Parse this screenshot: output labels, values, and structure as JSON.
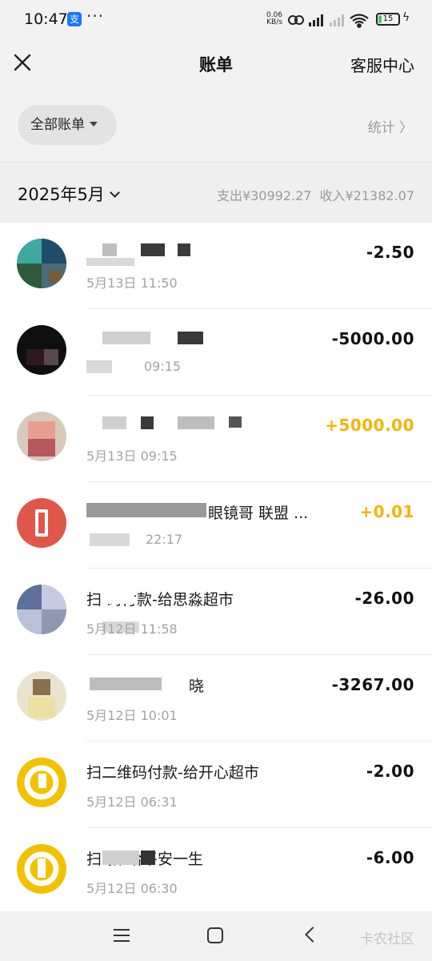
{
  "status_bar": {
    "time": "10:47",
    "app_badge": "支",
    "more": "···",
    "net_speed_value": "0.06",
    "net_speed_unit": "KB/s",
    "battery": "15",
    "battery_level": 0.15
  },
  "header": {
    "title": "账单",
    "service_label": "客服中心"
  },
  "filter": {
    "chip_label": "全部账单",
    "stats_label": "统计 〉"
  },
  "month": {
    "label": "2025年5月",
    "expense": "支出¥30992.27",
    "income": "收入¥21382.07"
  },
  "transactions": [
    {
      "title": "",
      "time": "5月13日 11:50",
      "amount": "-2.50",
      "type": "expense"
    },
    {
      "title": "",
      "time": "09:15",
      "amount": "-5000.00",
      "type": "expense"
    },
    {
      "title": "",
      "time": "5月13日 09:15",
      "amount": "+5000.00",
      "type": "income"
    },
    {
      "title": "眼镜哥 联盟 ...",
      "time": "22:17",
      "amount": "+0.01",
      "type": "income"
    },
    {
      "title": "扫 码付款-给思淼超市",
      "time": "5月12日 11:58",
      "amount": "-26.00",
      "type": "expense"
    },
    {
      "title": "晓",
      "time": "5月12日 10:01",
      "amount": "-3267.00",
      "type": "expense"
    },
    {
      "title": "扫二维码付款-给开心超市",
      "time": "5月12日 06:31",
      "amount": "-2.00",
      "type": "expense"
    },
    {
      "title": "扫 款-给平安一生",
      "time": "5月12日 06:30",
      "amount": "-6.00",
      "type": "expense"
    }
  ],
  "watermark": "卡农社区",
  "colors": {
    "income": "#f5b400",
    "background": "#f2f2f2",
    "list_background": "#ffffff",
    "muted_text": "#9a9a9a"
  }
}
